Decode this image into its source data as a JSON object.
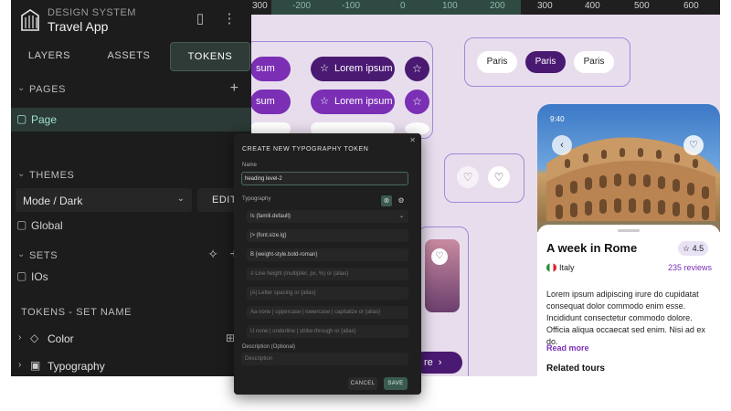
{
  "ruler": {
    "ticks": [
      "300",
      "-200",
      "-100",
      "0",
      "100",
      "200",
      "300",
      "400",
      "500",
      "600"
    ]
  },
  "sidebar": {
    "ds_label": "DESIGN SYSTEM",
    "app_name": "Travel App",
    "tabs": [
      {
        "label": "LAYERS"
      },
      {
        "label": "ASSETS"
      },
      {
        "label": "TOKENS"
      }
    ],
    "pages_title": "PAGES",
    "page_item": "Page",
    "themes_title": "THEMES",
    "mode_value": "Mode / Dark",
    "edit_label": "EDIT",
    "global_label": "Global",
    "sets_title": "SETS",
    "ios_label": "IOs",
    "tokens_set_title": "TOKENS - SET NAME",
    "tokens": [
      {
        "label": "Color"
      },
      {
        "label": "Typography"
      }
    ]
  },
  "canvas": {
    "chip_label": "Lorem ipsum",
    "chip_label_short": "sum",
    "chip_label_end": "re",
    "city_pills": [
      "Paris",
      "Paris",
      "Paris"
    ]
  },
  "phone": {
    "status_time": "9:40",
    "title": "A week in Rome",
    "rating": "4.5",
    "country": "Italy",
    "reviews": "235 reviews",
    "body": "Lorem ipsum adipiscing irure do cupidatat consequat dolor commodo enim esse. Incididunt consectetur commodo dolore. Officia aliqua occaecat sed enim. Nisi ad ex do.",
    "read_more": "Read more",
    "related": "Related tours"
  },
  "dialog": {
    "title": "CREATE NEW TYPOGRAPHY TOKEN",
    "name_label": "Name",
    "name_value": "heading level-2",
    "typography_label": "Typography",
    "fields": [
      {
        "prefix": "Is",
        "value": "{famili.default}"
      },
      {
        "prefix": "|>",
        "value": "{font.size.lg}"
      },
      {
        "prefix": "B",
        "value": "{weight-style.bold-roman}"
      },
      {
        "prefix": "≡",
        "value": "Line height (multiplier, px, %) or {alias}"
      },
      {
        "prefix": "|A|",
        "value": "Letter spacing or {alias}"
      },
      {
        "prefix": "Aa",
        "value": "none | uppercase | lowercase | capitalize or {alias}"
      },
      {
        "prefix": "U",
        "value": "none | underline | strike-through or {alias}"
      }
    ],
    "description_label": "Description (Optional)",
    "description_placeholder": "Description",
    "cancel": "CANCEL",
    "save": "SAVE"
  },
  "colors": {
    "accent": "#7a2fb5",
    "accent_dark": "#4a1a72",
    "canvas_bg": "#e8dded",
    "panel_bg": "#1c1c1c",
    "mint": "#9fe0cf"
  }
}
